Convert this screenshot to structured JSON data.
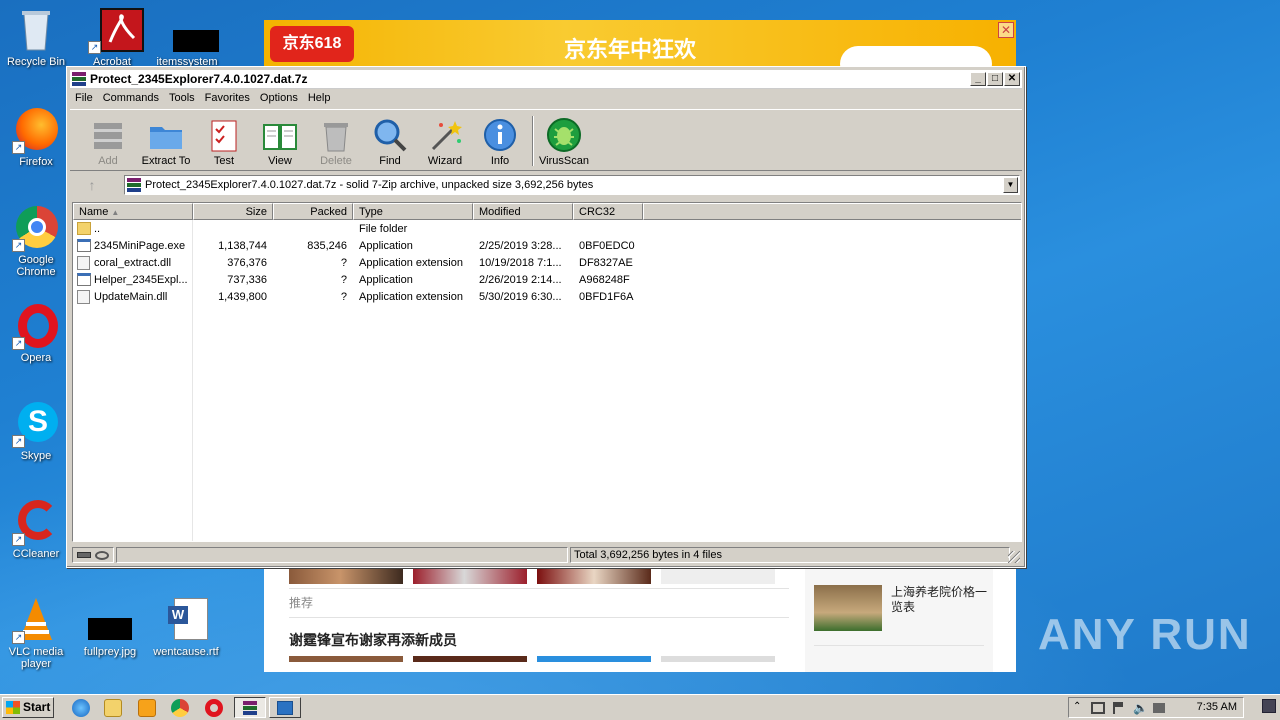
{
  "desktop": {
    "icons": [
      {
        "label": "Recycle Bin",
        "icon": "recycle-bin-icon"
      },
      {
        "label": "Acrobat",
        "icon": "acrobat-icon"
      },
      {
        "label": "itemssystem",
        "icon": "file-icon"
      },
      {
        "label": "Firefox",
        "icon": "firefox-icon"
      },
      {
        "label": "Google Chrome",
        "icon": "chrome-icon"
      },
      {
        "label": "Opera",
        "icon": "opera-icon"
      },
      {
        "label": "Skype",
        "icon": "skype-icon"
      },
      {
        "label": "CCleaner",
        "icon": "ccleaner-icon"
      },
      {
        "label": "VLC media player",
        "icon": "vlc-icon"
      },
      {
        "label": "fullprey.jpg",
        "icon": "image-file-icon"
      },
      {
        "label": "wentcause.rtf",
        "icon": "word-doc-icon"
      }
    ]
  },
  "browser": {
    "banner_logo": "京东618",
    "banner_slogan": "京东年中狂欢",
    "banner_close": "✕",
    "news_label": "推荐",
    "news_title": "谢霆锋宣布谢家再添新成员",
    "side_text": "上海养老院价格一览表"
  },
  "window": {
    "title": "Protect_2345Explorer7.4.0.1027.dat.7z",
    "minimize": "_",
    "maximize": "□",
    "close": "✕",
    "menu": [
      "File",
      "Commands",
      "Tools",
      "Favorites",
      "Options",
      "Help"
    ],
    "toolbar": [
      {
        "label": "Add",
        "icon": "add-archive-icon",
        "disabled": true
      },
      {
        "label": "Extract To",
        "icon": "extract-folder-icon",
        "disabled": false
      },
      {
        "label": "Test",
        "icon": "test-checklist-icon",
        "disabled": false
      },
      {
        "label": "View",
        "icon": "view-book-icon",
        "disabled": false
      },
      {
        "label": "Delete",
        "icon": "delete-trash-icon",
        "disabled": true
      },
      {
        "label": "Find",
        "icon": "find-magnifier-icon",
        "disabled": false
      },
      {
        "label": "Wizard",
        "icon": "wizard-wand-icon",
        "disabled": false
      },
      {
        "label": "Info",
        "icon": "info-icon",
        "disabled": false
      },
      {
        "label": "VirusScan",
        "icon": "virus-scan-icon",
        "disabled": false
      }
    ],
    "address": "Protect_2345Explorer7.4.0.1027.dat.7z - solid 7-Zip archive, unpacked size 3,692,256 bytes",
    "columns": [
      "Name",
      "Size",
      "Packed",
      "Type",
      "Modified",
      "CRC32"
    ],
    "rows": [
      {
        "name": "..",
        "size": "",
        "packed": "",
        "type": "File folder",
        "modified": "",
        "crc": "",
        "icon": "folder-icon"
      },
      {
        "name": "2345MiniPage.exe",
        "size": "1,138,744",
        "packed": "835,246",
        "type": "Application",
        "modified": "2/25/2019 3:28...",
        "crc": "0BF0EDC0",
        "icon": "exe-icon"
      },
      {
        "name": "coral_extract.dll",
        "size": "376,376",
        "packed": "?",
        "type": "Application extension",
        "modified": "10/19/2018 7:1...",
        "crc": "DF8327AE",
        "icon": "dll-icon"
      },
      {
        "name": "Helper_2345Expl...",
        "size": "737,336",
        "packed": "?",
        "type": "Application",
        "modified": "2/26/2019 2:14...",
        "crc": "A968248F",
        "icon": "exe-icon"
      },
      {
        "name": "UpdateMain.dll",
        "size": "1,439,800",
        "packed": "?",
        "type": "Application extension",
        "modified": "5/30/2019 6:30...",
        "crc": "0BFD1F6A",
        "icon": "dll-icon"
      }
    ],
    "status_total": "Total 3,692,256 bytes in 4 files"
  },
  "taskbar": {
    "start": "Start",
    "clock": "7:35 AM"
  },
  "watermark": "ANY RUN"
}
